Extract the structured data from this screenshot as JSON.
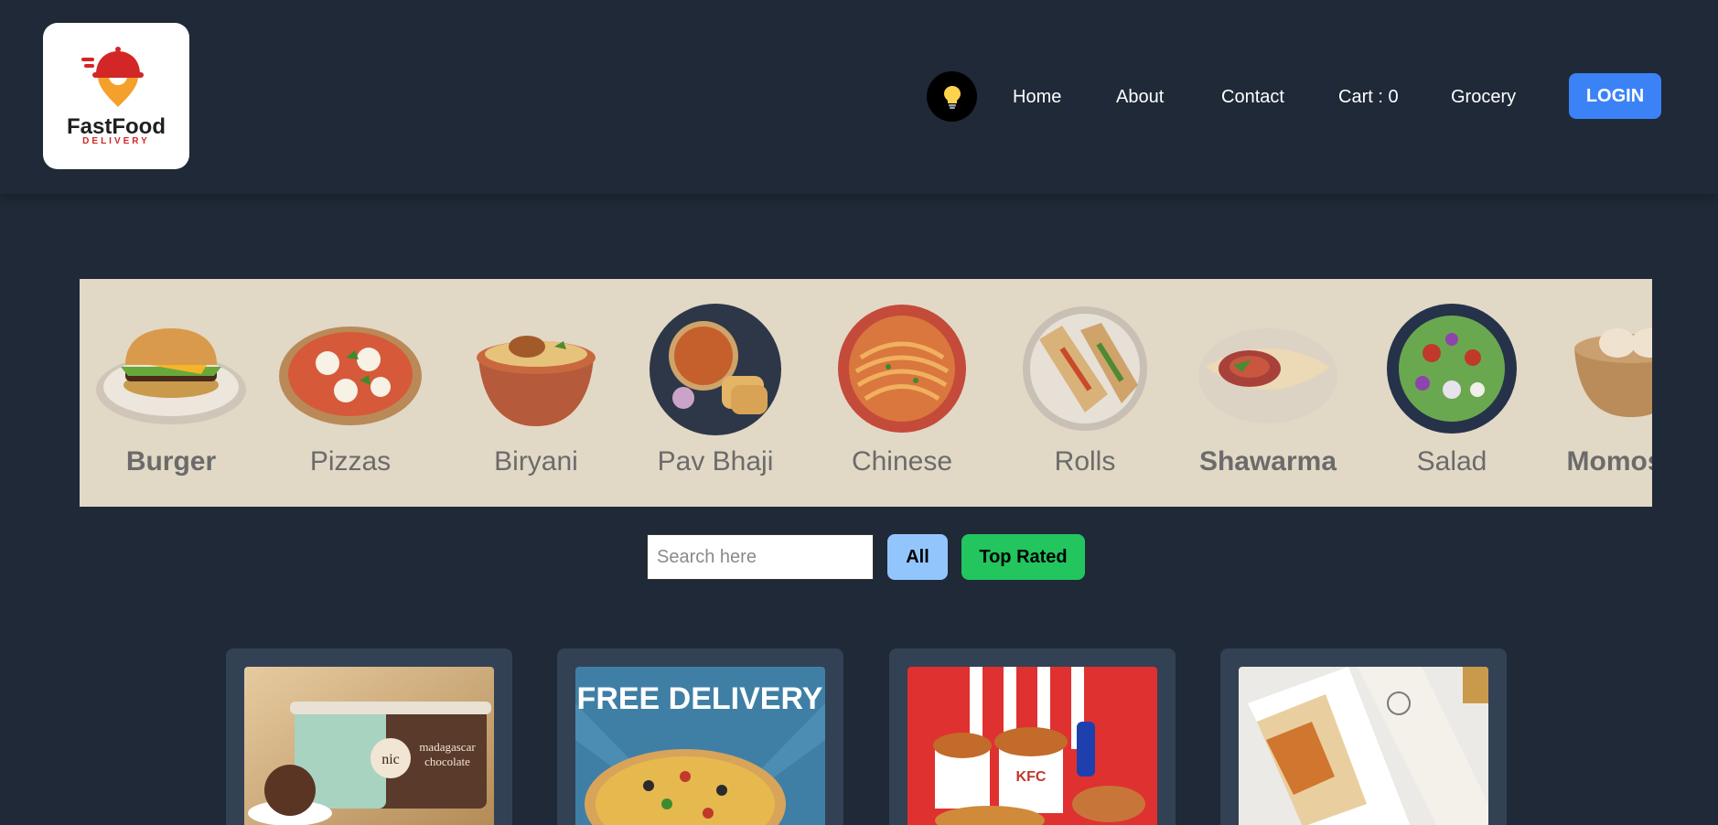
{
  "brand": {
    "name": "FastFood",
    "tagline": "DELIVERY"
  },
  "nav": {
    "theme_icon": "lightbulb-icon",
    "links": [
      "Home",
      "About",
      "Contact",
      "Cart : 0",
      "Grocery"
    ],
    "login_label": "LOGIN"
  },
  "categories": [
    {
      "label": "Burger",
      "icon": "burger-image"
    },
    {
      "label": "Pizzas",
      "icon": "pizza-image"
    },
    {
      "label": "Biryani",
      "icon": "biryani-image"
    },
    {
      "label": "Pav Bhaji",
      "icon": "pav-bhaji-image"
    },
    {
      "label": "Chinese",
      "icon": "noodles-image"
    },
    {
      "label": "Rolls",
      "icon": "rolls-image"
    },
    {
      "label": "Shawarma",
      "icon": "shawarma-image"
    },
    {
      "label": "Salad",
      "icon": "salad-image"
    },
    {
      "label": "Momos",
      "icon": "momos-image"
    }
  ],
  "search": {
    "placeholder": "Search here",
    "value": ""
  },
  "filters": {
    "all_label": "All",
    "top_rated_label": "Top Rated"
  },
  "cards": [
    {
      "image": "ice-cream-image",
      "banner_text_1": "madagascar",
      "banner_text_2": "chocolate",
      "brand_mark": "nic"
    },
    {
      "image": "pizza-promo-image",
      "banner_text": "FREE DELIVERY"
    },
    {
      "image": "kfc-bucket-image",
      "brand_mark": "KFC"
    },
    {
      "image": "wrap-rolls-image"
    }
  ],
  "colors": {
    "background": "#1f2937",
    "card": "#334155",
    "login": "#3b82f6",
    "all_button": "#93c5fd",
    "top_rated_button": "#22c55e",
    "banner": "#e2d8c6",
    "brand_red": "#d32626",
    "brand_orange": "#f5a02a"
  }
}
